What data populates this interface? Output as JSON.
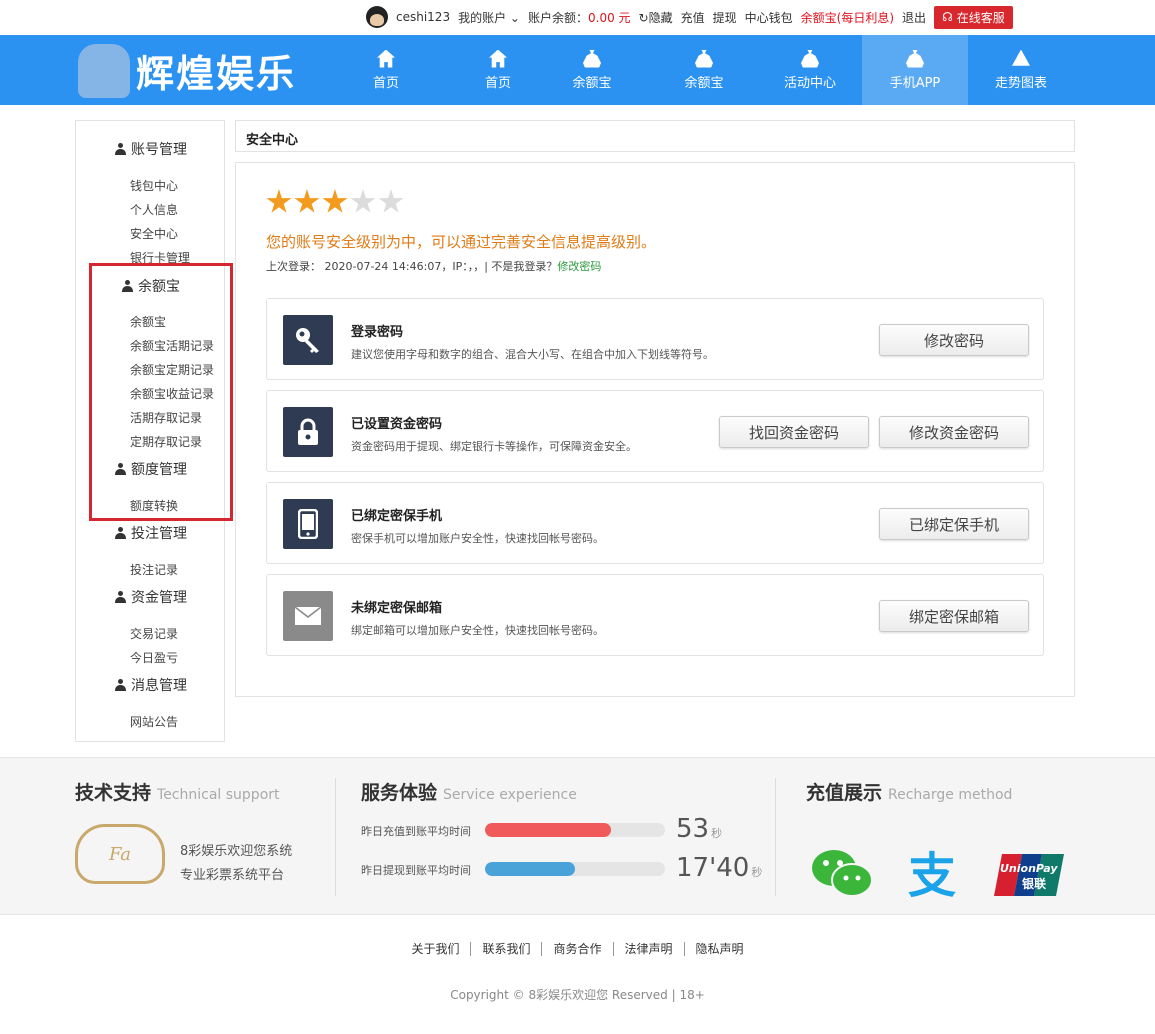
{
  "topbar": {
    "username": "ceshi123",
    "my_account": "我的账户",
    "balance_label": "账户余额：",
    "balance_value": "0.00 元",
    "hide": "隐藏",
    "recharge": "充值",
    "withdraw": "提现",
    "wallet": "中心钱包",
    "yuebao": "余额宝(每日利息)",
    "logout": "退出",
    "support": "在线客服"
  },
  "brand": {
    "name": "辉煌娱乐"
  },
  "nav": {
    "items": [
      {
        "label": "首页",
        "icon": "home-icon"
      },
      {
        "label": "首页",
        "icon": "home-icon"
      },
      {
        "label": "余额宝",
        "icon": "money-bag-icon"
      },
      {
        "label": "余额宝",
        "icon": "money-bag-icon"
      },
      {
        "label": "活动中心",
        "icon": "money-bag-icon"
      },
      {
        "label": "手机APP",
        "icon": "money-bag-icon"
      },
      {
        "label": "走势图表",
        "icon": "triangle-icon"
      }
    ],
    "active_index": 5
  },
  "sidebar": {
    "sections": [
      {
        "title": "账号管理",
        "items": [
          "钱包中心",
          "个人信息",
          "安全中心",
          "银行卡管理"
        ]
      },
      {
        "title": "余额宝",
        "items": [
          "余额宝",
          "余额宝活期记录",
          "余额宝定期记录",
          "余额宝收益记录",
          "活期存取记录",
          "定期存取记录"
        ]
      },
      {
        "title": "额度管理",
        "items": [
          "额度转换"
        ]
      },
      {
        "title": "投注管理",
        "items": [
          "投注记录"
        ]
      },
      {
        "title": "资金管理",
        "items": [
          "交易记录",
          "今日盈亏"
        ]
      },
      {
        "title": "消息管理",
        "items": [
          "网站公告"
        ]
      }
    ]
  },
  "breadcrumb": "安全中心",
  "security": {
    "stars_filled": 3,
    "stars_total": 5,
    "message": "您的账号安全级别为中，可以通过完善安全信息提高级别。",
    "last_login": "上次登录： 2020-07-24 14:46:07，IP：，，| 不是我登录？",
    "change_pwd_link": "修改密码",
    "cards": [
      {
        "icon": "key-icon",
        "title": "登录密码",
        "desc": "建议您使用字母和数字的组合、混合大小写、在组合中加入下划线等符号。",
        "buttons": [
          "修改密码"
        ]
      },
      {
        "icon": "lock-icon",
        "title": "已设置资金密码",
        "desc": "资金密码用于提现、绑定银行卡等操作，可保障资金安全。",
        "buttons": [
          "找回资金密码",
          "修改资金密码"
        ]
      },
      {
        "icon": "phone-icon",
        "title": "已绑定密保手机",
        "desc": "密保手机可以增加账户安全性，快速找回帐号密码。",
        "buttons": [
          "已绑定保手机"
        ]
      },
      {
        "icon": "mail-icon",
        "title": "未绑定密保邮箱",
        "desc": "绑定邮箱可以增加账户安全性，快速找回帐号密码。",
        "buttons": [
          "绑定密保邮箱"
        ]
      }
    ]
  },
  "footer": {
    "support": {
      "title": "技术支持",
      "subtitle": "Technical support",
      "line1": "8彩娱乐欢迎您系统",
      "line2": "专业彩票系统平台",
      "logo_text": "Fa"
    },
    "service": {
      "title": "服务体验",
      "subtitle": "Service experience",
      "rows": [
        {
          "label": "昨日充值到账平均时间",
          "value": "53",
          "unit": "秒",
          "fill": 0.7,
          "color": "#f05a5a"
        },
        {
          "label": "昨日提现到账平均时间",
          "value": "17'40",
          "unit": "秒",
          "fill": 0.5,
          "color": "#4aa3d8"
        }
      ]
    },
    "recharge": {
      "title": "充值展示",
      "subtitle": "Recharge method",
      "unionpay_text": "UnionPay",
      "unionpay_cn": "银联"
    },
    "links": [
      "关于我们",
      "联系我们",
      "商务合作",
      "法律声明",
      "隐私声明"
    ],
    "copyright": "Copyright © 8彩娱乐欢迎您 Reserved | 18+"
  }
}
